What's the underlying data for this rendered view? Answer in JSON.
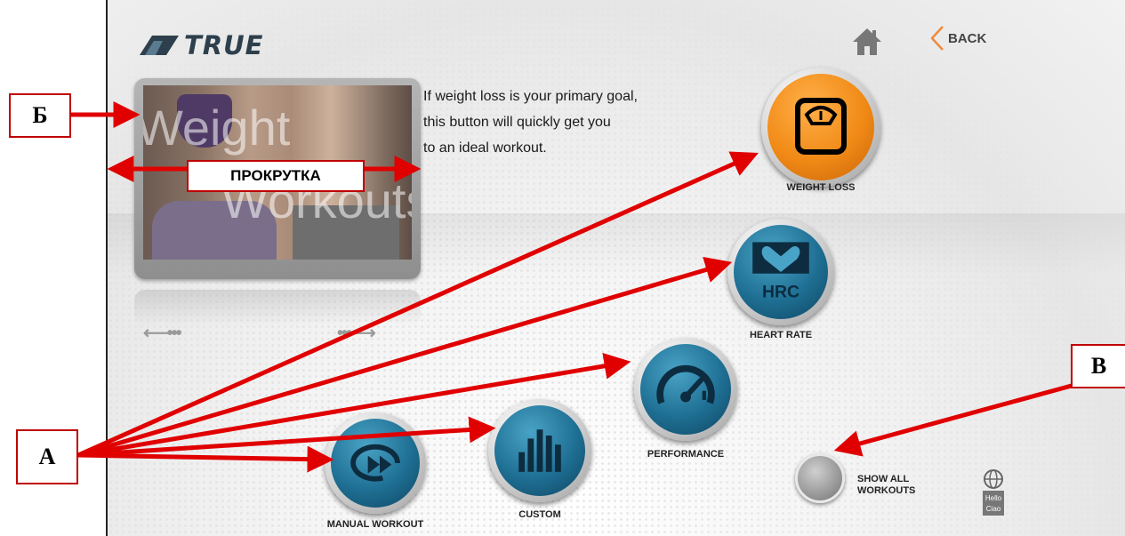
{
  "header": {
    "logo_text": "TRUE",
    "back_label": "BACK",
    "home_icon": "home-icon",
    "back_icon": "back-chevron-icon"
  },
  "video": {
    "line1": "Weight",
    "line2": "Workouts"
  },
  "description": {
    "lines": [
      "If weight loss is your primary goal,",
      "this button will quickly get you",
      "to an ideal workout."
    ]
  },
  "workouts": [
    {
      "label": "WEIGHT LOSS",
      "icon": "scale-icon",
      "color": "#f18a16"
    },
    {
      "label": "HEART RATE",
      "icon": "heart-hrc-icon",
      "icon_text": "HRC",
      "color": "#1e6f93"
    },
    {
      "label": "PERFORMANCE",
      "icon": "gauge-icon",
      "color": "#1e6f93"
    },
    {
      "label": "CUSTOM",
      "icon": "bars-icon",
      "color": "#1e6f93"
    },
    {
      "label": "MANUAL WORKOUT",
      "icon": "fast-forward-icon",
      "color": "#1e6f93"
    }
  ],
  "show_all": {
    "line1": "SHOW ALL",
    "line2": "WORKOUTS"
  },
  "language": {
    "line1": "Hello",
    "line2": "Ciao",
    "icon": "globe-icon"
  },
  "annotations": {
    "callout_b": "Б",
    "callout_a": "А",
    "callout_v": "В",
    "scroll_label": "ПРОКРУТКА",
    "arrow_color": "#e00000"
  }
}
